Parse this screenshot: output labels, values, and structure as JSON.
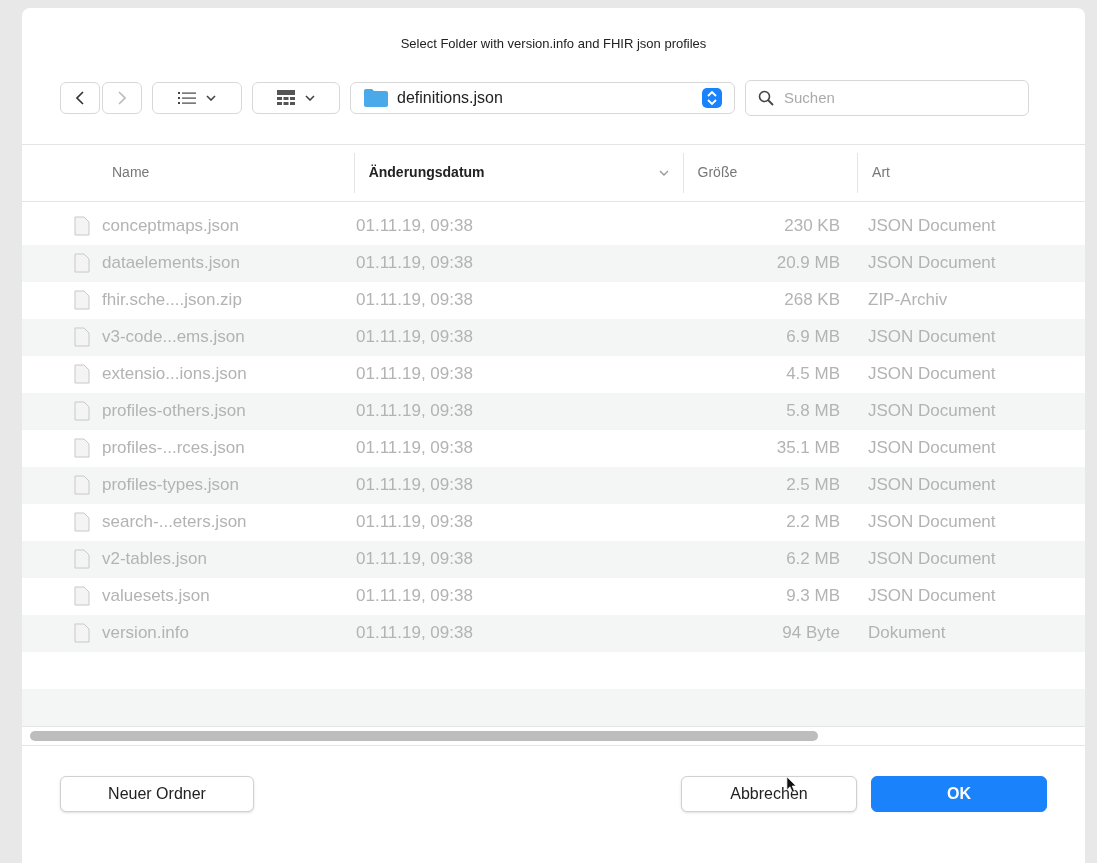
{
  "window": {
    "title": "Select Folder with version.info and FHIR json profiles"
  },
  "toolbar": {
    "location": "definitions.json",
    "search": {
      "placeholder": "Suchen"
    }
  },
  "columns": [
    {
      "label": "Name",
      "selected": false
    },
    {
      "label": "Änderungsdatum",
      "selected": true
    },
    {
      "label": "Größe",
      "selected": false
    },
    {
      "label": "Art",
      "selected": false
    }
  ],
  "rows": [
    {
      "name": "conceptmaps.json",
      "date": "01.11.19, 09:38",
      "size": "230 KB",
      "kind_label": "JSON Document",
      "disabled": true
    },
    {
      "name": "dataelements.json",
      "date": "01.11.19, 09:38",
      "size": "20.9 MB",
      "kind_label": "JSON Document",
      "disabled": true
    },
    {
      "name": "fhir.sche....json.zip",
      "date": "01.11.19, 09:38",
      "size": "268 KB",
      "kind_label": "ZIP-Archiv",
      "disabled": true
    },
    {
      "name": "v3-code...ems.json",
      "date": "01.11.19, 09:38",
      "size": "6.9 MB",
      "kind_label": "JSON Document",
      "disabled": true
    },
    {
      "name": "extensio...ions.json",
      "date": "01.11.19, 09:38",
      "size": "4.5 MB",
      "kind_label": "JSON Document",
      "disabled": true
    },
    {
      "name": "profiles-others.json",
      "date": "01.11.19, 09:38",
      "size": "5.8 MB",
      "kind_label": "JSON Document",
      "disabled": true
    },
    {
      "name": "profiles-...rces.json",
      "date": "01.11.19, 09:38",
      "size": "35.1 MB",
      "kind_label": "JSON Document",
      "disabled": true
    },
    {
      "name": "profiles-types.json",
      "date": "01.11.19, 09:38",
      "size": "2.5 MB",
      "kind_label": "JSON Document",
      "disabled": true
    },
    {
      "name": "search-...eters.json",
      "date": "01.11.19, 09:38",
      "size": "2.2 MB",
      "kind_label": "JSON Document",
      "disabled": true
    },
    {
      "name": "v2-tables.json",
      "date": "01.11.19, 09:38",
      "size": "6.2 MB",
      "kind_label": "JSON Document",
      "disabled": true
    },
    {
      "name": "valuesets.json",
      "date": "01.11.19, 09:38",
      "size": "9.3 MB",
      "kind_label": "JSON Document",
      "disabled": true
    },
    {
      "name": "version.info",
      "date": "01.11.19, 09:38",
      "size": "94 Byte",
      "kind_label": "Dokument",
      "disabled": true
    }
  ],
  "buttons": [
    {
      "label": "Neuer Ordner",
      "kind": "plain"
    },
    {
      "label": "Abbrechen",
      "kind": "plain"
    },
    {
      "label": "OK",
      "kind": "default"
    }
  ]
}
